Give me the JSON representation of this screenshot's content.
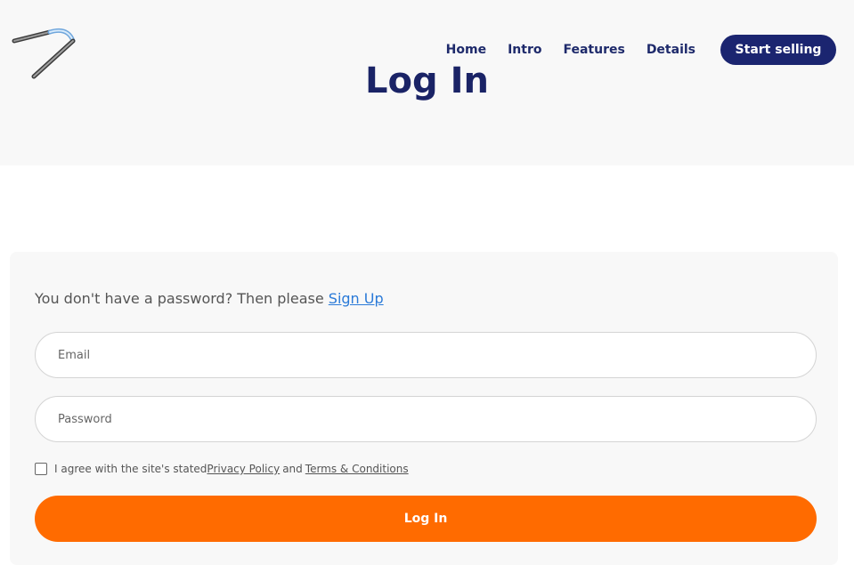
{
  "nav": {
    "items": [
      "Home",
      "Intro",
      "Features",
      "Details"
    ],
    "cta_label": "Start selling"
  },
  "page": {
    "title": "Log In"
  },
  "form": {
    "prompt_text": "You don't have a password? Then please ",
    "signup_link": "Sign Up",
    "email_placeholder": "Email",
    "password_placeholder": "Password",
    "agree_text": "I agree with the site's stated ",
    "privacy_link": "Privacy Policy",
    "and_text": "and",
    "terms_link": "Terms & Conditions",
    "submit_label": "Log In"
  },
  "colors": {
    "brand_navy": "#1b2570",
    "accent_orange": "#ff6b00",
    "link_blue": "#2a7ad8"
  },
  "icons": {
    "logo": "pen-logo-icon"
  }
}
